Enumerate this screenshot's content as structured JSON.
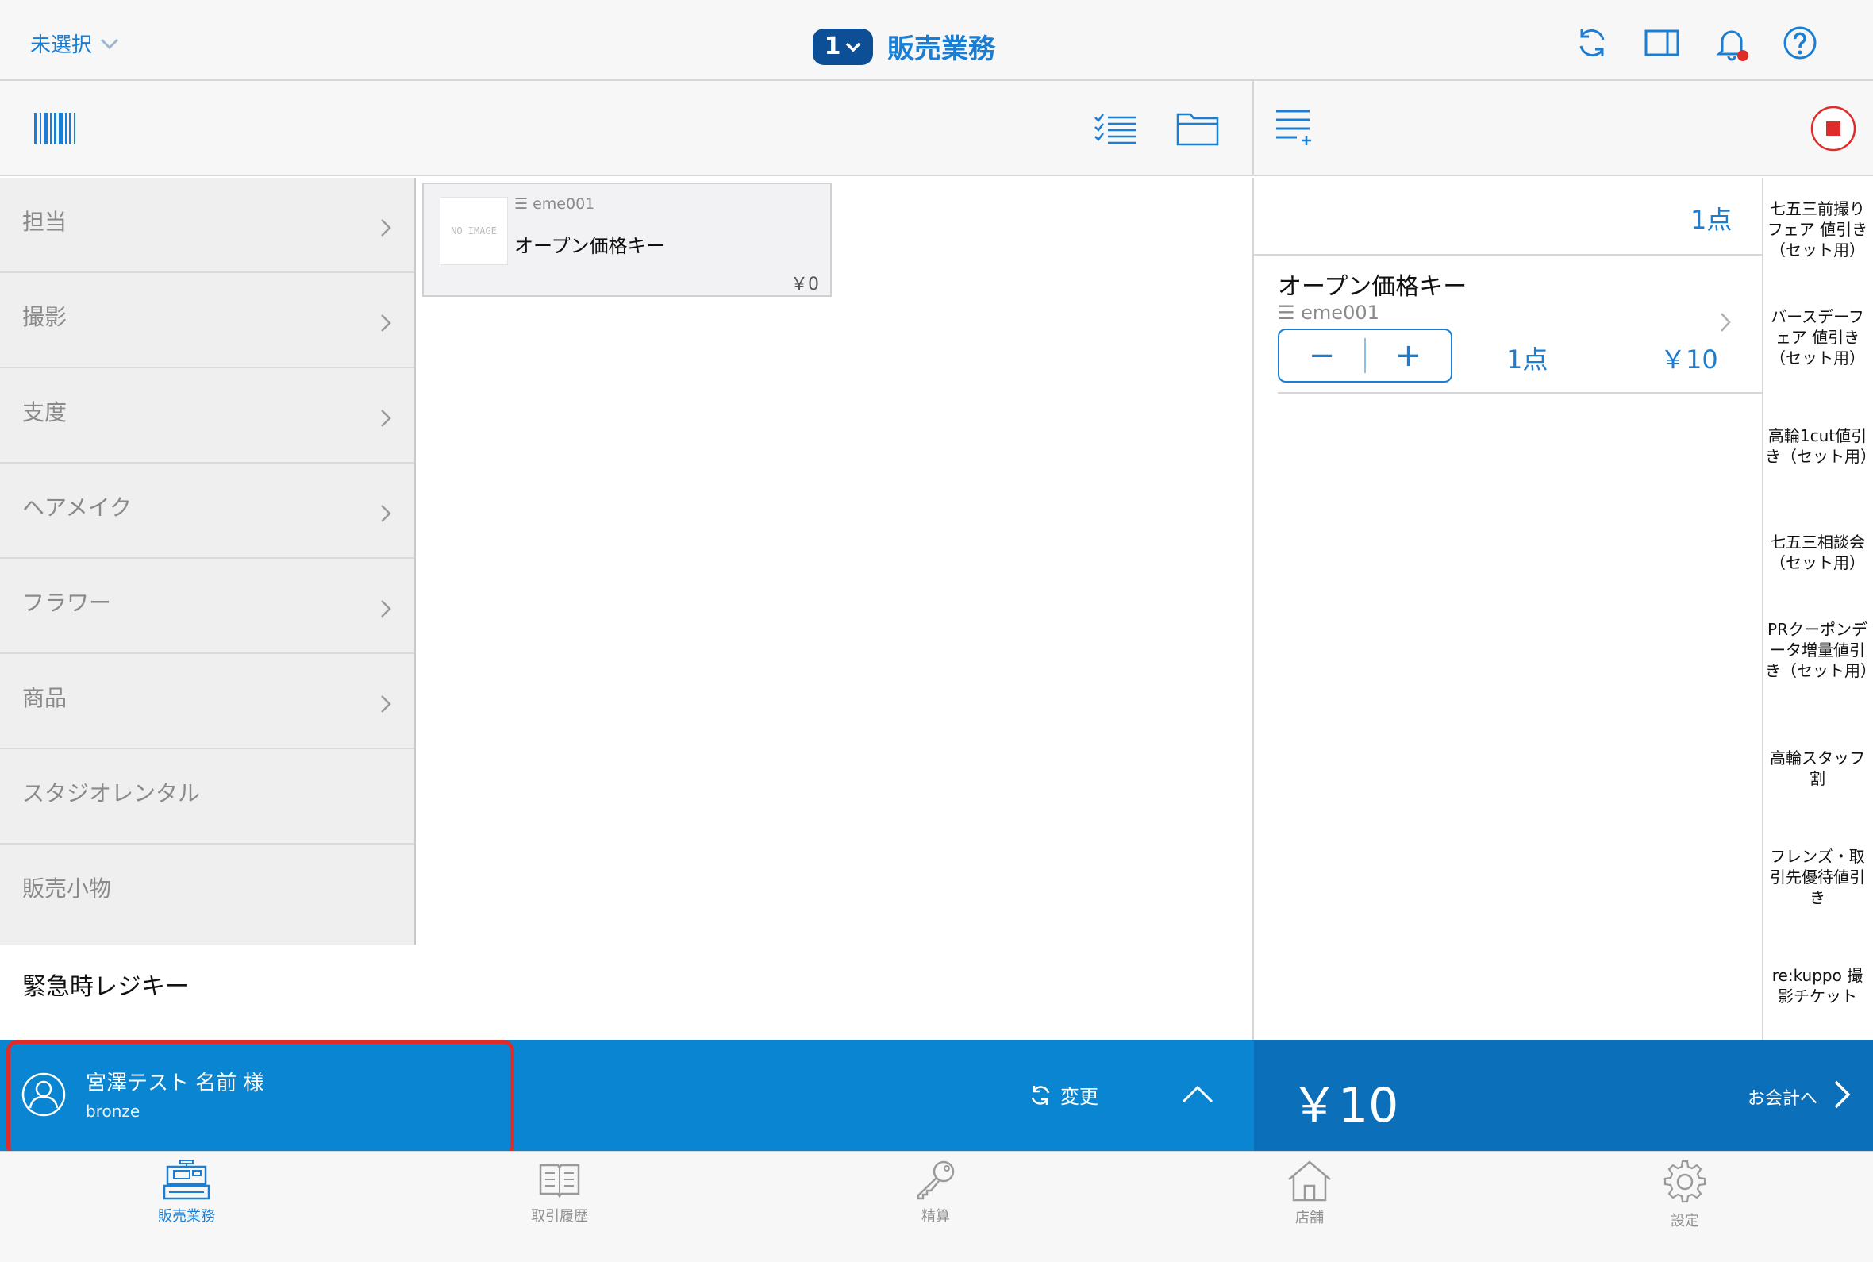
{
  "header": {
    "unselected_label": "未選択",
    "register_number": "1",
    "title": "販売業務"
  },
  "categories": [
    {
      "label": "担当"
    },
    {
      "label": "撮影"
    },
    {
      "label": "支度"
    },
    {
      "label": "ヘアメイク"
    },
    {
      "label": "フラワー"
    },
    {
      "label": "商品"
    },
    {
      "label": "スタジオレンタル"
    },
    {
      "label": "販売小物"
    }
  ],
  "emergency_key": "緊急時レジキー",
  "product_tile": {
    "image_placeholder": "NO IMAGE",
    "code": "eme001",
    "name": "オープン価格キー",
    "price": "￥0"
  },
  "cart": {
    "count": "1点",
    "item": {
      "name": "オープン価格キー",
      "code": "eme001",
      "minus": "−",
      "plus": "+",
      "qty": "1点",
      "price": "￥10"
    }
  },
  "discount_keys": [
    {
      "label": "七五三前撮りフェア 値引き（セット用）"
    },
    {
      "label": "バースデーフェア 値引き（セット用）"
    },
    {
      "label": "高輪1cut値引き（セット用）"
    },
    {
      "label": "七五三相談会（セット用）"
    },
    {
      "label": "PRクーポンデータ増量値引き（セット用）"
    },
    {
      "label": "高輪スタッフ割"
    },
    {
      "label": "フレンズ・取引先優待値引き"
    },
    {
      "label": "re:kuppo 撮影チケット"
    }
  ],
  "customer": {
    "name": "宮澤テスト 名前 様",
    "rank": "bronze",
    "change_label": "変更"
  },
  "total": {
    "amount": "￥10",
    "checkout_label": "お会計へ"
  },
  "tabs": [
    {
      "label": "販売業務",
      "icon": "register-icon",
      "active": true
    },
    {
      "label": "取引履歴",
      "icon": "book-icon",
      "active": false
    },
    {
      "label": "精算",
      "icon": "key-icon",
      "active": false
    },
    {
      "label": "店舗",
      "icon": "house-icon",
      "active": false
    },
    {
      "label": "設定",
      "icon": "gear-icon",
      "active": false
    }
  ],
  "colors": {
    "accent": "#1a7fd4",
    "customer_bar": "#0a85d1",
    "total_bar": "#0c6fba",
    "highlight": "#e02b2b",
    "notification_dot": "#e02b2b"
  }
}
